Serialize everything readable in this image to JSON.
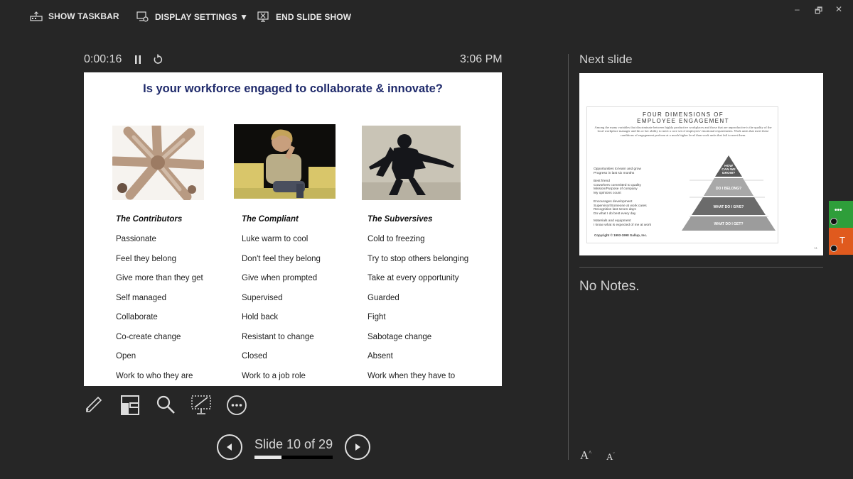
{
  "topbar": {
    "show_taskbar": "SHOW TASKBAR",
    "display_settings": "DISPLAY SETTINGS ▼",
    "end_slide_show": "END SLIDE SHOW"
  },
  "window_controls": {
    "minimize": "–",
    "restore": "🗗",
    "close": "✕"
  },
  "presenter": {
    "elapsed_time": "0:00:16",
    "clock": "3:06 PM",
    "next_slide_label": "Next slide",
    "notes": "No Notes."
  },
  "current_slide": {
    "title": "Is your workforce engaged to collaborate & innovate?",
    "columns": [
      {
        "heading": "The Contributors",
        "items": [
          "Passionate",
          "Feel they belong",
          "Give more than they get",
          "Self managed",
          "Collaborate",
          "Co-create change",
          "Open",
          "Work to who they are"
        ]
      },
      {
        "heading": "The Compliant",
        "items": [
          "Luke warm to cool",
          "Don't feel they belong",
          "Give when prompted",
          "Supervised",
          "Hold back",
          "Resistant to change",
          "Closed",
          "Work to a job role"
        ]
      },
      {
        "heading": "The Subversives",
        "items": [
          "Cold to freezing",
          "Try to stop others belonging",
          "Take at every opportunity",
          "Guarded",
          "Fight",
          "Sabotage change",
          "Absent",
          "Work when they have to"
        ]
      }
    ]
  },
  "next_slide": {
    "title_line1": "FOUR DIMENSIONS OF",
    "title_line2": "EMPLOYEE ENGAGEMENT",
    "intro": "Among the many variables that discriminate between highly productive workplaces and those that are unproductive is the quality of the local workplace manager and his or her ability to meet a core set of employees' emotional requirements. Work units that meet these conditions of engagement perform at a much higher level than work units that fail to meet them.",
    "groups": [
      {
        "items": [
          "Opportunities to learn and grow",
          "Progress in last six months"
        ],
        "level": "HOW CAN WE GROW?"
      },
      {
        "items": [
          "Best friend",
          "Coworkers committed to quality",
          "Mission/Purpose of company",
          "My opinions count"
        ],
        "level": "DO I BELONG?"
      },
      {
        "items": [
          "Encourages development",
          "Supervisor/Someone at work cares",
          "Recognition last seven days",
          "Do what I do best every day"
        ],
        "level": "WHAT DO I GIVE?"
      },
      {
        "items": [
          "Materials and equipment",
          "I know what is expected of me at work"
        ],
        "level": "WHAT DO I GET?"
      }
    ],
    "copyright": "Copyright © 1993-1998 Gallup, Inc.",
    "page_number": "11"
  },
  "navigation": {
    "slide_counter": "Slide 10 of 29",
    "current": 10,
    "total": 29,
    "progress_fraction": 0.345
  },
  "font_buttons": {
    "increase": "A",
    "decrease": "A"
  },
  "edge_tabs": {
    "more": "•••",
    "text_tab": "T"
  },
  "colors": {
    "background": "#262626",
    "title_blue": "#1f2a6b",
    "green_tab": "#2e9e3a",
    "orange_tab": "#e05a1e"
  }
}
